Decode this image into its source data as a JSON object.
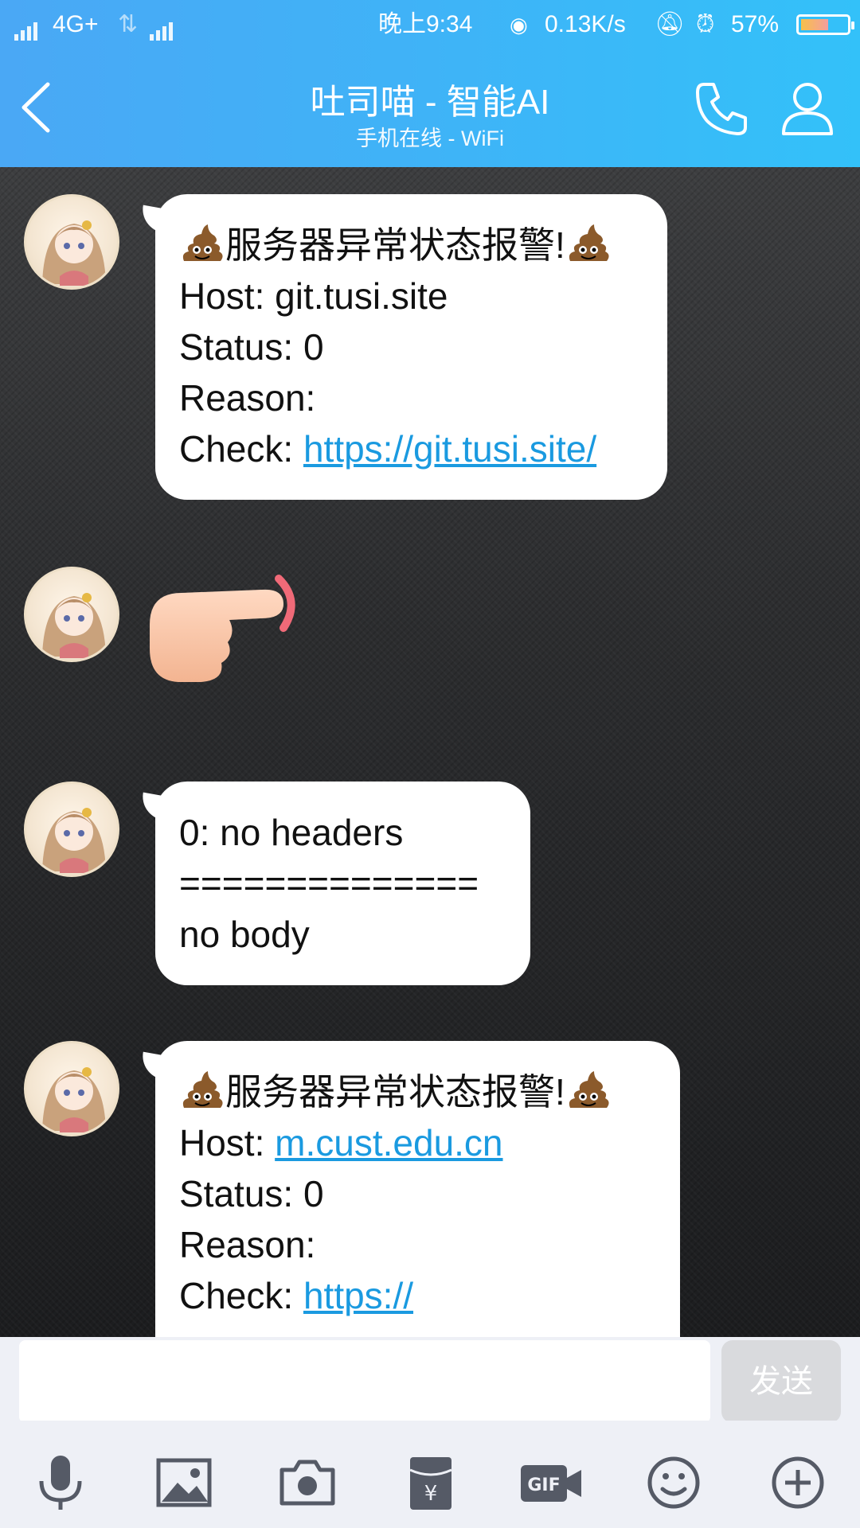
{
  "status_bar": {
    "network": "4G+",
    "time": "晚上9:34",
    "speed": "0.13K/s",
    "battery": "57%"
  },
  "header": {
    "title": "吐司喵 - 智能AI",
    "subtitle": "手机在线 - WiFi"
  },
  "messages": [
    {
      "alert": "服务器异常状态报警!",
      "host_label": "Host: ",
      "host": "git.tusi.site",
      "status": "Status: 0",
      "reason": "Reason:",
      "check_label": "Check: ",
      "check_link": "https://git.tusi.site/"
    },
    {
      "line1": "0: no headers",
      "line2": "==============",
      "line3": "no body"
    },
    {
      "alert": "服务器异常状态报警!",
      "host_label": "Host: ",
      "host": "m.cust.edu.cn",
      "status": "Status: 0",
      "reason": "Reason:",
      "check_label": "Check: ",
      "check_link": "https://"
    }
  ],
  "input": {
    "send_label": "发送"
  },
  "icons": [
    "back-icon",
    "phone-icon",
    "profile-icon",
    "microphone-icon",
    "image-icon",
    "camera-icon",
    "red-packet-icon",
    "gif-icon",
    "emoji-icon",
    "plus-icon"
  ],
  "colors": {
    "header_start": "#4aa8f5",
    "header_end": "#33c1f9",
    "link": "#1a9ae0"
  }
}
